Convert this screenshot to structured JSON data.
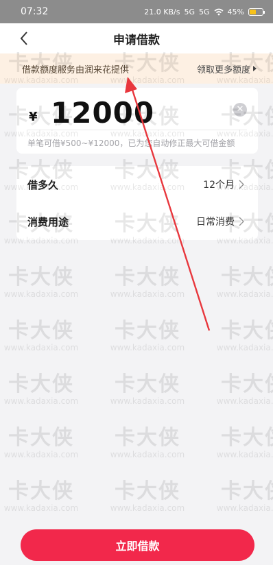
{
  "status_bar": {
    "time": "07:32",
    "speed": "21.0 KB/s",
    "network_1": "5G",
    "network_2": "5G",
    "battery": "45%"
  },
  "nav": {
    "title": "申请借款",
    "back_icon": "chevron-left-icon"
  },
  "notice": {
    "text": "借款额度服务由润来花提供",
    "link": "领取更多额度"
  },
  "amount": {
    "currency": "¥",
    "value": "12000",
    "hint": "单笔可借¥500~¥12000，已为您自动修正最大可借金额",
    "clear_icon": "clear-icon"
  },
  "options": [
    {
      "label": "借多久",
      "value": "12个月"
    },
    {
      "label": "消费用途",
      "value": "日常消费"
    }
  ],
  "watermark": {
    "big": "卡大侠",
    "small": "www.kadaxia.com"
  },
  "submit_label": "立即借款",
  "colors": {
    "accent": "#f2284b",
    "notice_bg": "#fdf0e3",
    "annotation_arrow": "#e8373d"
  }
}
